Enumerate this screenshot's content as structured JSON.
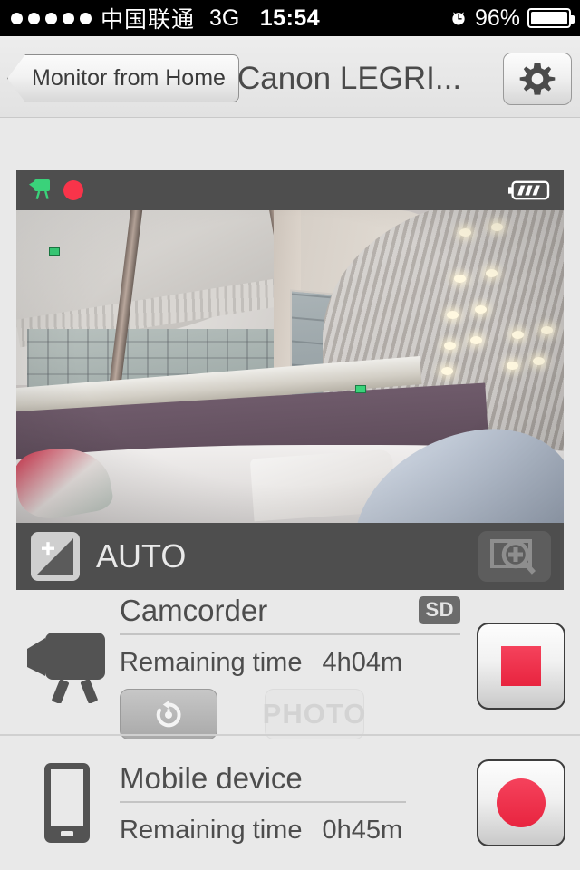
{
  "status_bar": {
    "signal_dots": 5,
    "carrier": "中国联通",
    "network": "3G",
    "time": "15:54",
    "alarm_icon": "alarm-clock-icon",
    "battery_percent": "96%"
  },
  "nav": {
    "back_label": "Monitor from Home",
    "title": "Canon LEGRI...",
    "settings_icon": "gear-icon"
  },
  "viewer": {
    "recording_icon": "camcorder-icon",
    "recording_dot": "record-indicator",
    "battery_icon": "battery-3-bars-icon",
    "exposure_icon": "exposure-compensation-icon",
    "exposure_value": "AUTO",
    "zoom_icon": "magnify-plus-icon",
    "scene_description": "Indoor room with curved glass roof, windows, recessed ceiling lights"
  },
  "devices": [
    {
      "icon": "camcorder-tripod-icon",
      "title": "Camcorder",
      "badge": "SD",
      "remaining_label": "Remaining time",
      "remaining_value": "4h04m",
      "timer_icon": "self-timer-icon",
      "photo_label": "PHOTO",
      "photo_enabled": false,
      "record_state": "stop",
      "record_color": "#ef2f48"
    },
    {
      "icon": "mobile-phone-icon",
      "title": "Mobile device",
      "badge": "",
      "remaining_label": "Remaining time",
      "remaining_value": "0h45m",
      "timer_icon": "",
      "photo_label": "",
      "photo_enabled": false,
      "record_state": "record",
      "record_color": "#ef2f48"
    }
  ],
  "colors": {
    "accent_red": "#ef2f48",
    "panel_dark": "#4e4e4e",
    "background": "#e9e9e9",
    "text": "#4d4d4d",
    "indicator_green": "#3ad27a"
  }
}
